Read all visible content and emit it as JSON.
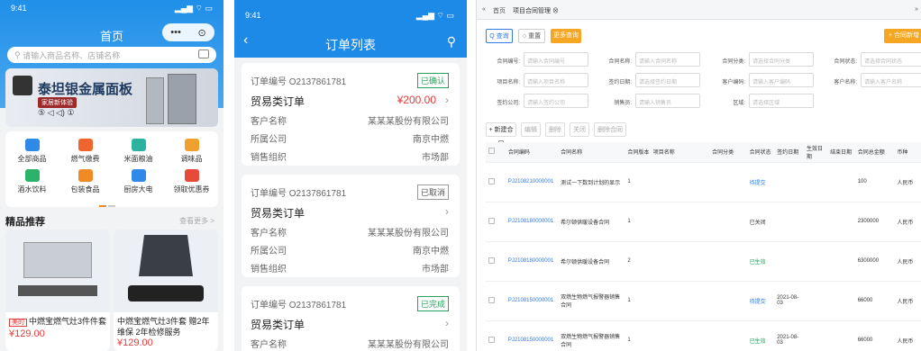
{
  "phone1": {
    "status_time": "9:41",
    "title": "首页",
    "search_placeholder": "请输入商品名称、店铺名称",
    "banner_title": "泰坦银金属面板",
    "banner_sub": "家居新体验",
    "banner_icons": "⑤ ◁ ◁) ①",
    "categories": [
      {
        "label": "全部商品",
        "color": "#2e8ae6"
      },
      {
        "label": "燃气缴费",
        "color": "#f0642e"
      },
      {
        "label": "米面粮油",
        "color": "#2bb3a0"
      },
      {
        "label": "调味品",
        "color": "#f0a02e"
      },
      {
        "label": "酒水饮料",
        "color": "#2bb36a"
      },
      {
        "label": "包装食品",
        "color": "#f08a24"
      },
      {
        "label": "厨房大电",
        "color": "#2e8ae6"
      },
      {
        "label": "领取优惠券",
        "color": "#e84a3a"
      }
    ],
    "section_title": "精品推荐",
    "more_label": "查看更多 >",
    "products": [
      {
        "tag": "美的",
        "name": "中燃宝燃气灶3件件套",
        "price": "¥129.00"
      },
      {
        "tag": "",
        "name": "中燃宝燃气灶3件套 赠2年维保 2年检修服务",
        "price": "¥129.00"
      }
    ]
  },
  "phone2": {
    "status_time": "9:41",
    "title": "订单列表",
    "orders": [
      {
        "no": "订单编号 O2137861781",
        "status": "已确认",
        "status_color": "#2aa15a",
        "type": "贸易类订单",
        "amount": "¥200.00",
        "customer_label": "客户名称",
        "customer": "某某某股份有限公司",
        "company_label": "所属公司",
        "company": "南京中燃",
        "org_label": "销售组织",
        "org": "市场部"
      },
      {
        "no": "订单编号 O2137861781",
        "status": "已取消",
        "status_color": "#555555",
        "type": "贸易类订单",
        "amount": "",
        "customer_label": "客户名称",
        "customer": "某某某股份有限公司",
        "company_label": "所属公司",
        "company": "南京中燃",
        "org_label": "销售组织",
        "org": "市场部"
      },
      {
        "no": "订单编号 O2137861781",
        "status": "已完成",
        "status_color": "#2aa15a",
        "type": "贸易类订单",
        "amount": "",
        "customer_label": "客户名称",
        "customer": "某某某股份有限公司"
      }
    ]
  },
  "web": {
    "tab_home": "首页",
    "tab_current": "项目合同管理 ⊗",
    "btn_search": "Q 查询",
    "btn_reset": "○ 重置",
    "btn_advanced": "更多查询",
    "btn_add": "+ 合同新增",
    "filters": [
      {
        "label": "合同编号:",
        "placeholder": "请输入合同编号"
      },
      {
        "label": "合同名称:",
        "placeholder": "请输入合同名称"
      },
      {
        "label": "合同分类:",
        "placeholder": "请选择合同分类"
      },
      {
        "label": "合同状态:",
        "placeholder": "请选择合同状态"
      },
      {
        "label": "项目名称:",
        "placeholder": "请输入项目名称"
      },
      {
        "label": "签约日期:",
        "placeholder": "请选择签约日期"
      },
      {
        "label": "客户编码:",
        "placeholder": "请输入客户编码"
      },
      {
        "label": "客户名称:",
        "placeholder": "请输入客户名称"
      },
      {
        "label": "签约公司:",
        "placeholder": "请输入签约公司"
      },
      {
        "label": "销售员:",
        "placeholder": "请输入销售员"
      },
      {
        "label": "区域:",
        "placeholder": "请选择区域"
      }
    ],
    "toolbar": [
      "+ 新建合同",
      "编辑",
      "删除",
      "关闭",
      "删除合同"
    ],
    "columns": [
      "合同编码",
      "合同名称",
      "合同版本",
      "项目名称",
      "合同分类",
      "合同状态",
      "签约日期",
      "生效日期",
      "结束日期",
      "合同总金额",
      "币种"
    ],
    "rows": [
      {
        "code": "PJ2108210000001",
        "name": "测试一下数到计划的显示",
        "ver": "1",
        "status": "待提交",
        "sign": "",
        "amount": "100",
        "cur": "人民币"
      },
      {
        "code": "PJ2108180000001",
        "name": "希尔顿供暖设备合同",
        "ver": "1",
        "status": "已关闭",
        "sign": "",
        "amount": "2300000",
        "cur": "人民币"
      },
      {
        "code": "PJ2108180000001",
        "name": "希尔顿供暖设备合同",
        "ver": "2",
        "status": "已生效",
        "sign": "",
        "amount": "6300000",
        "cur": "人民币"
      },
      {
        "code": "PJ2108150000001",
        "name": "双燃生物燃气报警器销售合同",
        "ver": "1",
        "status": "待提交",
        "sign": "2021-08-03",
        "amount": "66000",
        "cur": "人民币"
      },
      {
        "code": "PJ2108150000001",
        "name": "双燃生物燃气报警器销售合同",
        "ver": "1",
        "status": "已生效",
        "sign": "2021-08-03",
        "amount": "66000",
        "cur": "人民币"
      }
    ]
  }
}
